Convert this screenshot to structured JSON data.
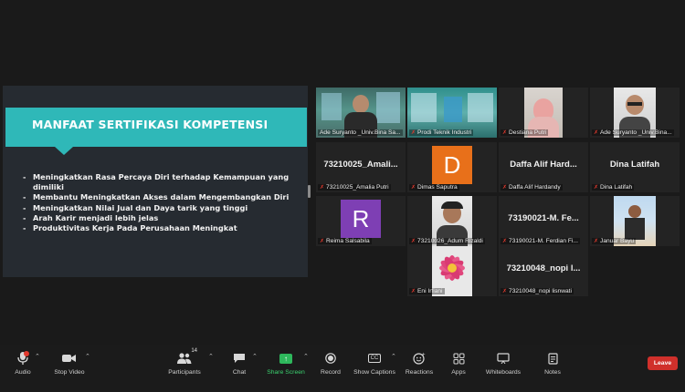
{
  "shared_screen": {
    "title": "MANFAAT SERTIFIKASI KOMPETENSI",
    "bullets": [
      "Meningkatkan Rasa Percaya Diri terhadap Kemampuan yang dimiliki",
      "Membantu Meningkatkan Akses dalam Mengembangkan Diri",
      "Meningkatkan Nilai Jual dan Daya tarik yang tinggi",
      "Arah Karir menjadi lebih jelas",
      "Produktivitas Kerja Pada Perusahaan Meningkat"
    ]
  },
  "gallery": [
    {
      "name": "Ade Suryanto _Univ.Bina Sa...",
      "muted": false,
      "kind": "video",
      "speaking": true
    },
    {
      "name": "Prodi Teknik Industri",
      "muted": true,
      "kind": "video"
    },
    {
      "name": "Destiana Putri",
      "muted": true,
      "kind": "video"
    },
    {
      "name": "Ade Suryanto _Univ.Bina...",
      "muted": true,
      "kind": "video"
    },
    {
      "name": "73210025_Amalia Putri",
      "muted": true,
      "kind": "text",
      "center": "73210025_Amali..."
    },
    {
      "name": "Dimas Saputra",
      "muted": true,
      "kind": "letter",
      "letter": "D",
      "color": "#e8701a"
    },
    {
      "name": "Daffa Alif Hardandy",
      "muted": true,
      "kind": "text",
      "center": "Daffa Alif Hard..."
    },
    {
      "name": "Dina Latifah",
      "muted": true,
      "kind": "text",
      "center": "Dina Latifah"
    },
    {
      "name": "Reima Salsabila",
      "muted": true,
      "kind": "letter",
      "letter": "R",
      "color": "#7e3fb4"
    },
    {
      "name": "73210026_Adum Rizaldi",
      "muted": true,
      "kind": "video"
    },
    {
      "name": "73190021-M. Ferdian Fi...",
      "muted": true,
      "kind": "text",
      "center": "73190021-M. Fe..."
    },
    {
      "name": "Januar Bayu",
      "muted": true,
      "kind": "video"
    },
    {
      "name": "Eni Irfiani",
      "muted": true,
      "kind": "image"
    },
    {
      "name": "73210048_nopi lisnwati",
      "muted": true,
      "kind": "text",
      "center": "73210048_nopi l..."
    }
  ],
  "toolbar": {
    "audio": "Audio",
    "stop_video": "Stop Video",
    "participants": "Participants",
    "participants_count": "14",
    "chat": "Chat",
    "share_screen": "Share Screen",
    "record": "Record",
    "show_captions": "Show Captions",
    "reactions": "Reactions",
    "apps": "Apps",
    "whiteboards": "Whiteboards",
    "notes": "Notes",
    "leave": "Leave"
  }
}
